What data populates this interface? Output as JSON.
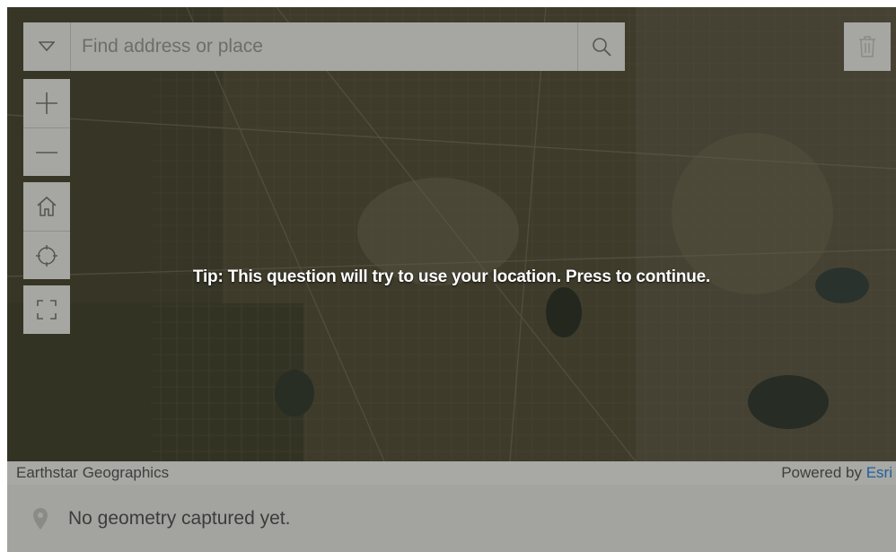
{
  "search": {
    "placeholder": "Find address or place",
    "toggle_icon": "chevron-down-icon",
    "search_icon": "search-icon"
  },
  "controls": {
    "zoom_in_icon": "plus-icon",
    "zoom_out_icon": "minus-icon",
    "home_icon": "home-icon",
    "locate_icon": "crosshair-icon",
    "fullscreen_icon": "fullscreen-icon",
    "trash_icon": "trash-icon"
  },
  "map": {
    "tip": "Tip: This question will try to use your location. Press to continue.",
    "attribution_left": "Earthstar Geographics",
    "attribution_powered": "Powered by ",
    "attribution_link": "Esri"
  },
  "status": {
    "icon": "map-pin-icon",
    "message": "No geometry captured yet."
  },
  "colors": {
    "control_bg": "#a6a6a2",
    "overlay_text": "#ffffff",
    "link": "#1f5f9c"
  }
}
